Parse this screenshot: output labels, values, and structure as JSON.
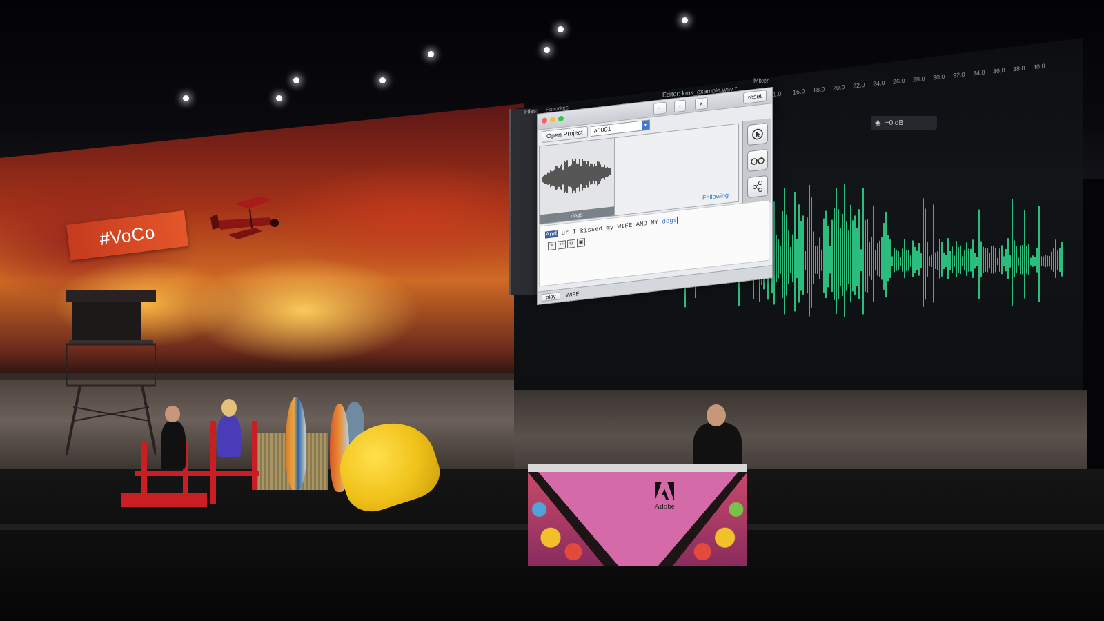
{
  "scene": {
    "hashtag_banner": "#VoCo",
    "podium_brand": "Adobe"
  },
  "editor": {
    "document_tab": "Editor: kmk_example.wav *",
    "mixer_tab": "Mixer",
    "panel_tabs": [
      "Files",
      "Favorites"
    ],
    "timeline_ticks": [
      "1.0",
      "16.0",
      "18.0",
      "20.0",
      "22.0",
      "24.0",
      "26.0",
      "28.0",
      "30.0",
      "32.0",
      "34.0",
      "36.0",
      "38.0",
      "40.0"
    ],
    "level_readout": "+0 dB"
  },
  "app": {
    "toolbar": {
      "open_project_label": "Open Project",
      "project_value": "a0001",
      "add_label": "+",
      "remove_label": "-",
      "close_label": "x",
      "reset_label": "reset"
    },
    "waveform_label": "dogs",
    "following_label": "Following",
    "transcript": {
      "selected_word": "And",
      "text_middle": " ur I kissed my WIFE AND MY ",
      "last_word": "dogs"
    },
    "status": {
      "play_label": "play",
      "current_word": "WIFE"
    }
  },
  "colors": {
    "waveform_green": "#2fd08a",
    "voco_banner": "#d9472a",
    "podium_pink": "#d46ba8",
    "selection_blue": "#3a5fa8"
  },
  "icons": [
    "cursor-icon",
    "glasses-icon",
    "share-icon"
  ]
}
